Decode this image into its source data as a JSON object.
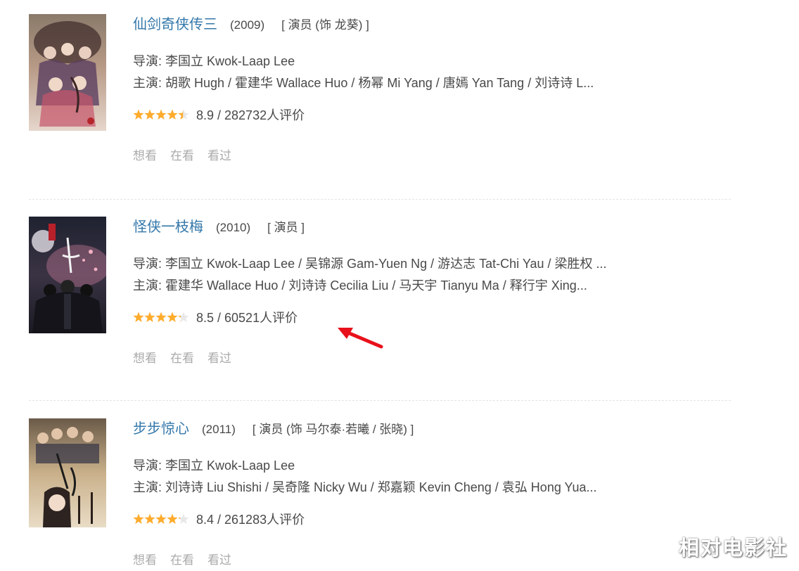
{
  "entries": [
    {
      "title": "仙剑奇侠传三",
      "year": "(2009)",
      "role": "[ 演员 (饰 龙葵) ]",
      "directors": "导演: 李国立 Kwok-Laap Lee",
      "cast": "主演: 胡歌 Hugh / 霍建华 Wallace Huo / 杨幂 Mi Yang / 唐嫣 Yan Tang / 刘诗诗 L...",
      "score": 8.9,
      "rating": "8.9 / 282732人评价",
      "actions": [
        "想看",
        "在看",
        "看过"
      ]
    },
    {
      "title": "怪侠一枝梅",
      "year": "(2010)",
      "role": "[ 演员 ]",
      "directors": "导演: 李国立 Kwok-Laap Lee / 吴锦源 Gam-Yuen Ng / 游达志 Tat-Chi Yau / 梁胜权 ...",
      "cast": "主演: 霍建华 Wallace Huo / 刘诗诗 Cecilia Liu / 马天宇 Tianyu Ma / 释行宇 Xing...",
      "score": 8.5,
      "rating": "8.5 / 60521人评价",
      "actions": [
        "想看",
        "在看",
        "看过"
      ]
    },
    {
      "title": "步步惊心",
      "year": "(2011)",
      "role": "[ 演员 (饰 马尔泰·若曦 / 张晓) ]",
      "directors": "导演: 李国立 Kwok-Laap Lee",
      "cast": "主演: 刘诗诗 Liu Shishi / 吴奇隆 Nicky Wu / 郑嘉颖 Kevin Cheng / 袁弘 Hong Yua...",
      "score": 8.4,
      "rating": "8.4 / 261283人评价",
      "actions": [
        "想看",
        "在看",
        "看过"
      ]
    }
  ],
  "colors": {
    "title_link": "#3377aa",
    "text": "#494949",
    "action_text": "#aaaaaa",
    "star": "#ffac2d",
    "arrow": "#e8111b"
  },
  "watermark": "相对电影社"
}
